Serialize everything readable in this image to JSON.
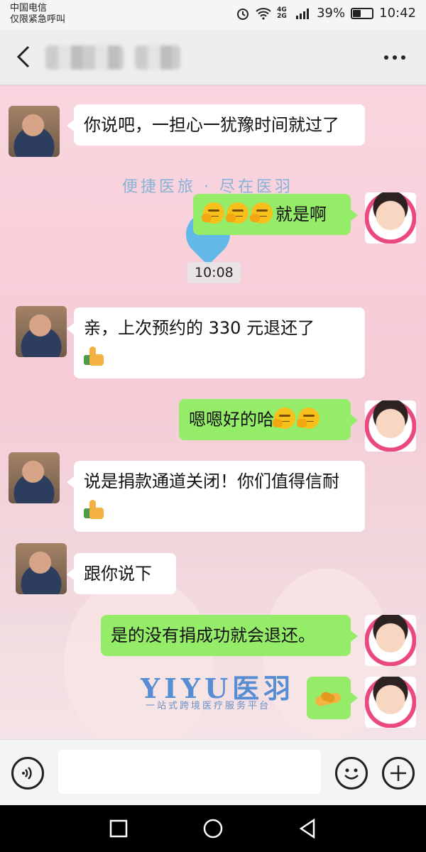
{
  "status_bar": {
    "carrier_line1": "中国电信",
    "carrier_line2": "仅限紧急呼叫",
    "signal_label": "4G 2G",
    "battery_percent": "39%",
    "battery_level": 0.39,
    "time": "10:42",
    "icons": [
      "alarm-icon",
      "wifi-icon",
      "signal-icon",
      "battery-icon"
    ]
  },
  "header": {
    "back_icon": "chevron-left-icon",
    "more_icon": "more-dots-icon"
  },
  "chat": {
    "background_watermark": "便捷医旅 · 尽在医羽",
    "logo_text": "YIYU医羽",
    "logo_subtitle": "一站式跨境医疗服务平台",
    "timestamp": "10:08",
    "messages": [
      {
        "side": "left",
        "text": "你说吧，一担心一犹豫时间就过了"
      },
      {
        "side": "right",
        "text": "就是啊",
        "emoji": "hmm-face-emoji x3"
      },
      {
        "side": "left",
        "text": "亲，上次预约的 330 元退还了",
        "emoji": "thumbs-up-emoji"
      },
      {
        "side": "right",
        "text": "嗯嗯好的哈",
        "emoji": "hmm-face-emoji x2"
      },
      {
        "side": "left",
        "text": "说是捐款通道关闭！你们值得信耐",
        "emoji": "thumbs-up-emoji"
      },
      {
        "side": "left",
        "text": "跟你说下"
      },
      {
        "side": "right",
        "text": "是的没有捐成功就会退还。"
      },
      {
        "side": "right",
        "text": "",
        "emoji": "handshake-emoji"
      }
    ]
  },
  "input_bar": {
    "voice_icon": "voice-icon",
    "emoji_icon": "emoji-icon",
    "plus_icon": "plus-icon",
    "input_value": ""
  },
  "nav_bar": {
    "icons": [
      "recents-icon",
      "home-icon",
      "back-triangle-icon"
    ]
  },
  "colors": {
    "green_bubble": "#95ec69",
    "white_bubble": "#ffffff",
    "chat_background": "#f6cbd6"
  }
}
